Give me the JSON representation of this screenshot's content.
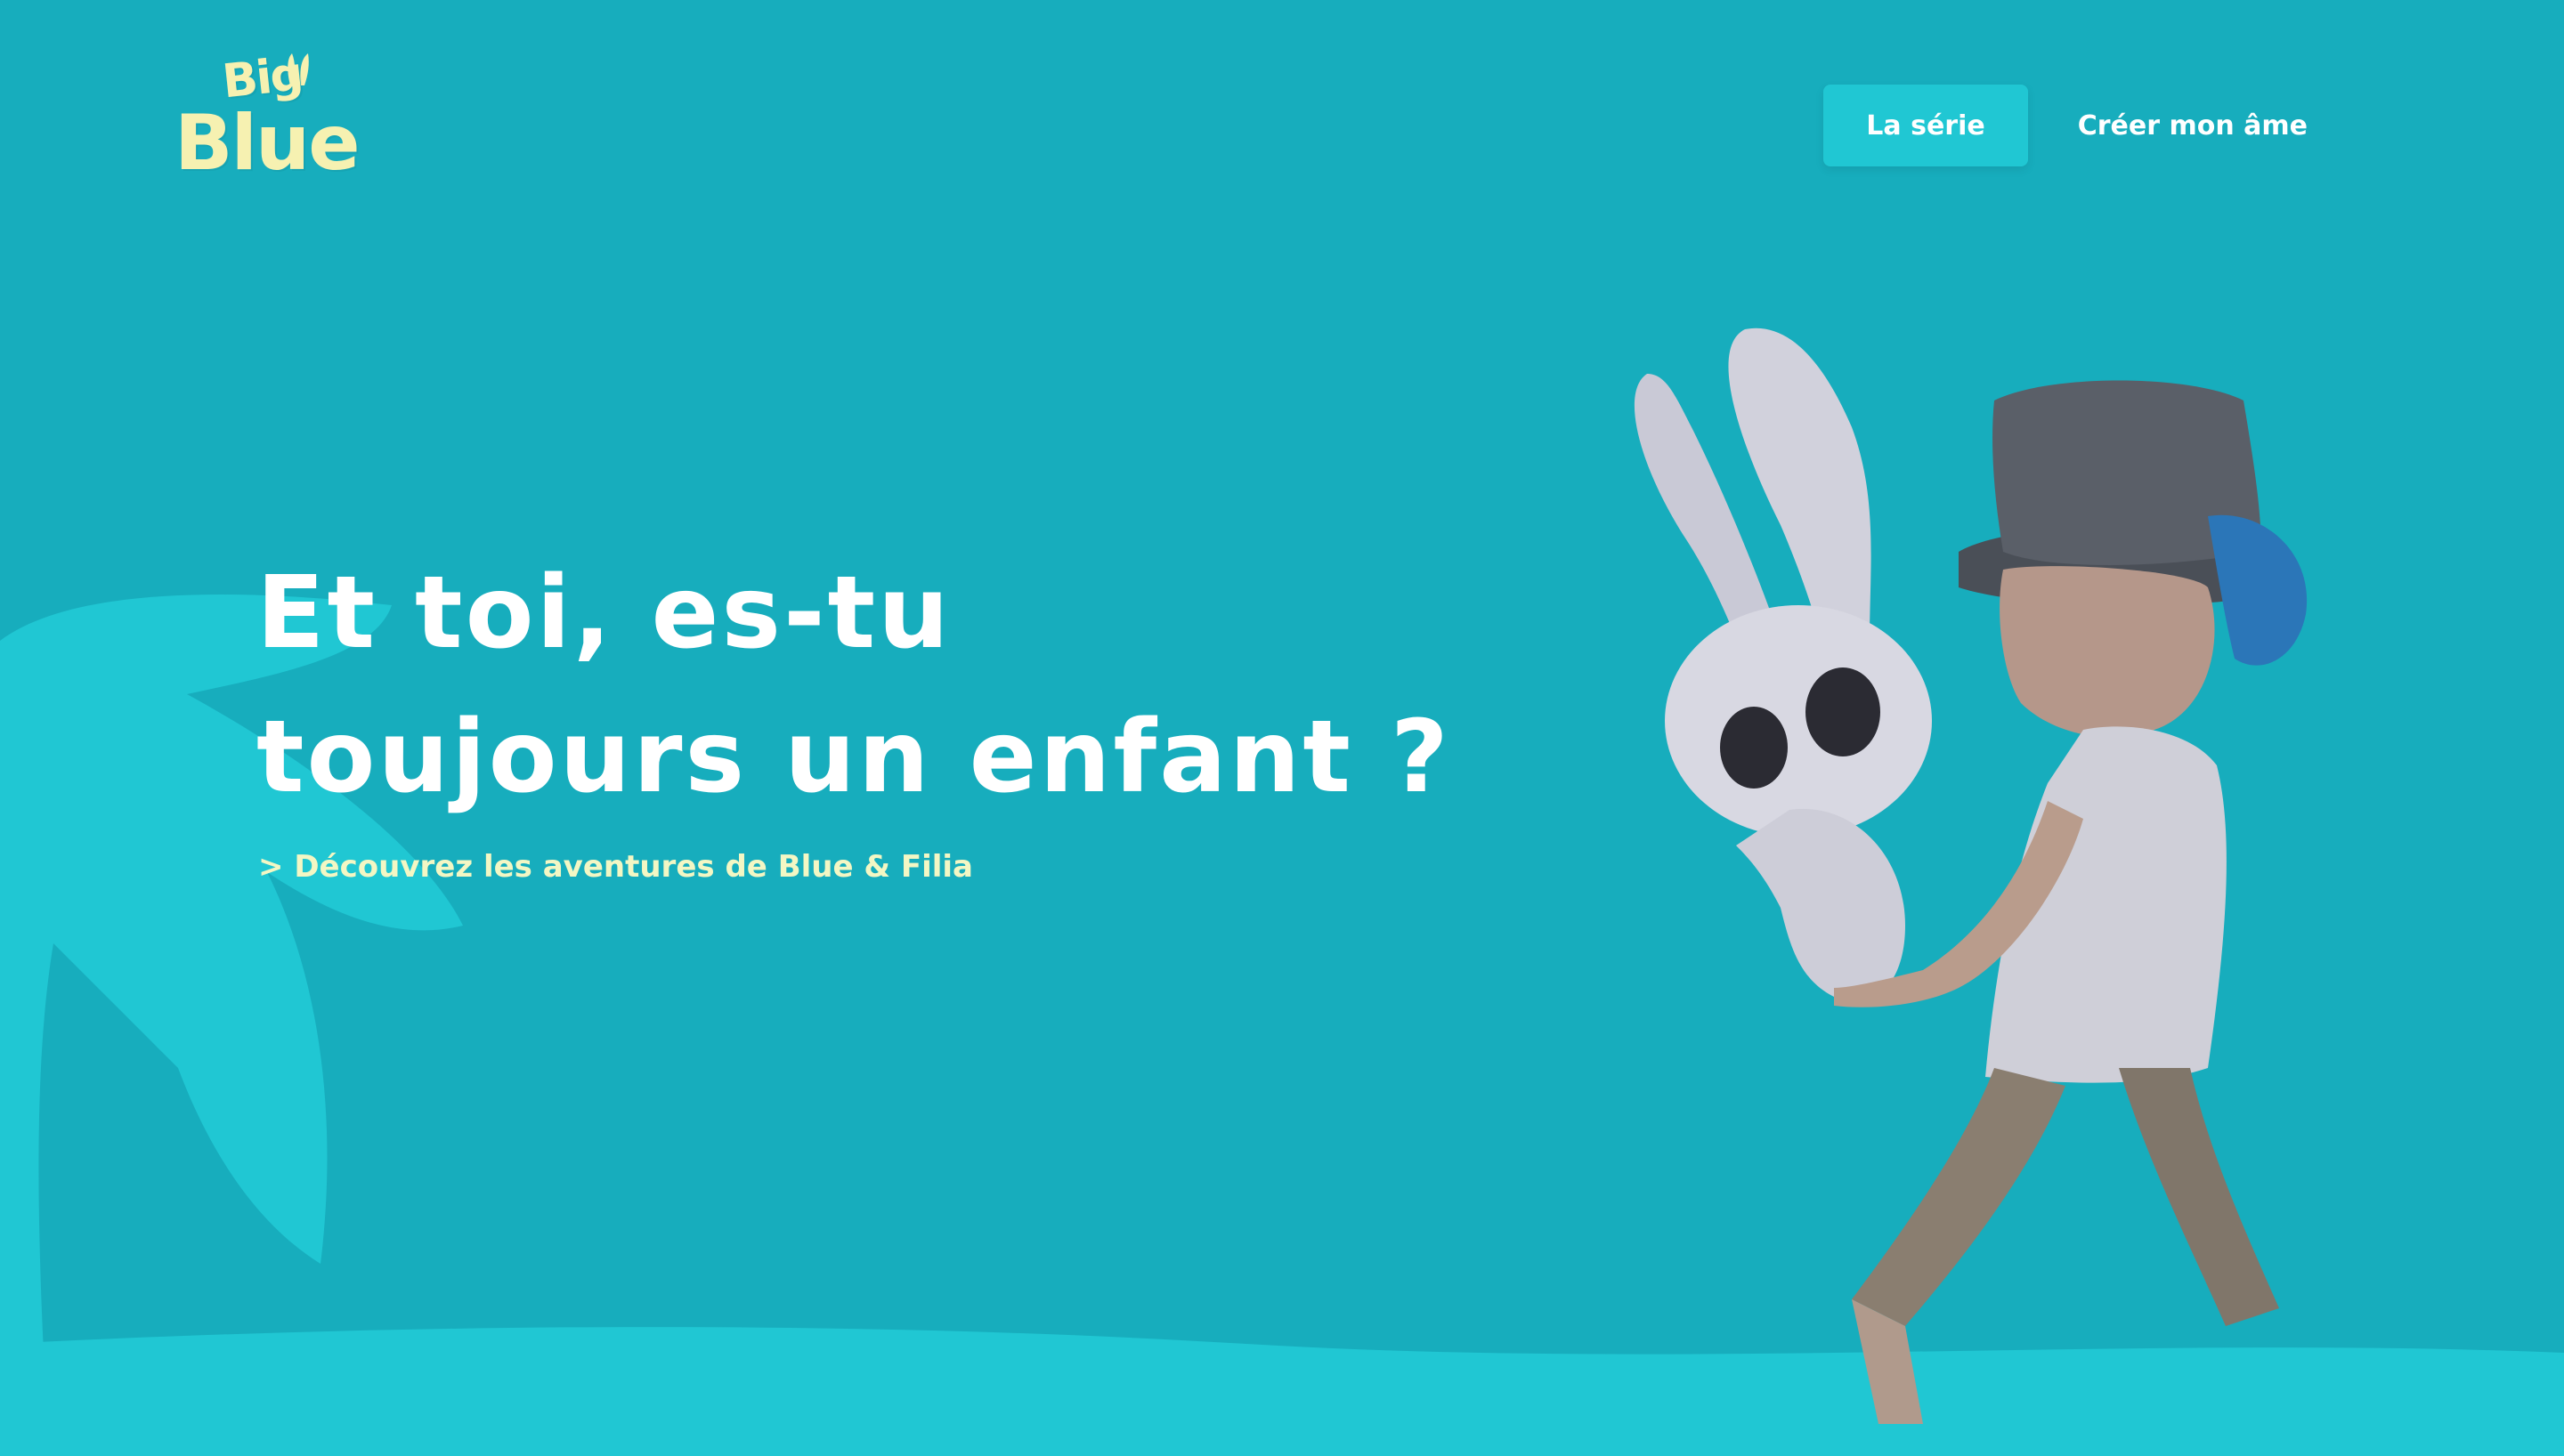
{
  "brand": {
    "logo_top": "Big",
    "logo_bottom": "Blue"
  },
  "nav": {
    "items": [
      {
        "label": "La série",
        "active": true
      },
      {
        "label": "Créer mon âme",
        "active": false
      }
    ]
  },
  "hero": {
    "title_line1": "Et toi, es-tu",
    "title_line2": "toujours un enfant ?",
    "cta": "> Découvrez les aventures de Blue & Filia"
  },
  "colors": {
    "background": "#17adbd",
    "accent": "#20c7d3",
    "logo": "#f6f1b1",
    "cta": "#f3f7c4"
  }
}
